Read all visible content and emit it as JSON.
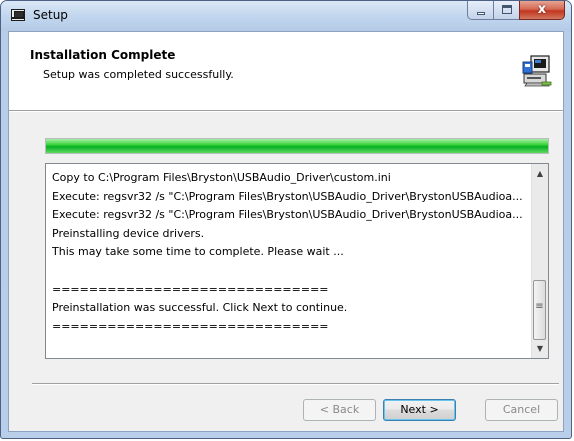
{
  "window": {
    "title": "Setup",
    "icon": "setup-app-icon"
  },
  "header": {
    "title": "Installation Complete",
    "subtitle": "Setup was completed successfully.",
    "icon": "computer-setup-icon"
  },
  "progress": {
    "value_percent": 100,
    "color": "#06b025"
  },
  "log": {
    "lines": [
      "Copy to C:\\Program Files\\Bryston\\USBAudio_Driver\\custom.ini",
      "Execute: regsvr32 /s \"C:\\Program Files\\Bryston\\USBAudio_Driver\\BrystonUSBAudioa...",
      "Execute: regsvr32 /s \"C:\\Program Files\\Bryston\\USBAudio_Driver\\BrystonUSBAudioa...",
      "Preinstalling device drivers.",
      "This may take some time to complete. Please wait ...",
      "",
      "==============================",
      "Preinstallation was successful. Click Next to continue.",
      "=============================="
    ]
  },
  "buttons": {
    "back_label": "< Back",
    "next_label": "Next >",
    "cancel_label": "Cancel"
  },
  "caption_buttons": {
    "close_glyph": "x"
  }
}
